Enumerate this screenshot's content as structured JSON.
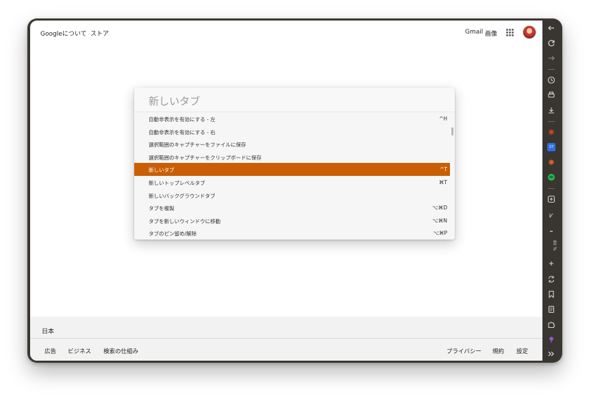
{
  "google_page": {
    "top_left_links": [
      "Googleについて",
      "ストア"
    ],
    "top_right_links": {
      "gmail": "Gmail",
      "images": "画像"
    },
    "footer": {
      "country": "日本",
      "left_links": [
        "広告",
        "ビジネス",
        "検索の仕組み"
      ],
      "right_links": [
        "プライバシー",
        "規約",
        "設定"
      ]
    }
  },
  "command_palette": {
    "placeholder": "新しいタブ",
    "rows": [
      {
        "label": "自動非表示を有効にする - 左",
        "shortcut": "^H"
      },
      {
        "label": "自動非表示を有効にする - 右",
        "shortcut": ""
      },
      {
        "label": "選択範囲のキャプチャーをファイルに保存",
        "shortcut": ""
      },
      {
        "label": "選択範囲のキャプチャーをクリップボードに保存",
        "shortcut": ""
      },
      {
        "label": "新しいタブ",
        "shortcut": "^T"
      },
      {
        "label": "新しいトップレベルタブ",
        "shortcut": "⌘T"
      },
      {
        "label": "新しいバックグラウンドタブ",
        "shortcut": ""
      },
      {
        "label": "タブを複製",
        "shortcut": "⌥⌘D"
      },
      {
        "label": "タブを新しいウィンドウに移動",
        "shortcut": "⌥⌘N"
      },
      {
        "label": "タブのピン留め/解除",
        "shortcut": "⌥⌘P"
      }
    ],
    "selected_index": 4,
    "selected_color": "#c95e05"
  },
  "sidebar": {
    "icons": [
      "back-arrow-icon",
      "reload-icon",
      "forward-arrow-icon",
      "history-icon",
      "print-icon",
      "download-icon",
      "bug-icon",
      "calendar-icon",
      "bug-icon",
      "spotify-icon",
      "add-panel-icon",
      "zoom-out-icon",
      "zoom-in-icon",
      "translate-icon",
      "bookmark-icon",
      "notes-icon",
      "extensions-icon",
      "podcast-icon",
      "more-icon"
    ],
    "calendar_date": "27",
    "zoom_level": "80 %",
    "accent_color": "#393530"
  }
}
